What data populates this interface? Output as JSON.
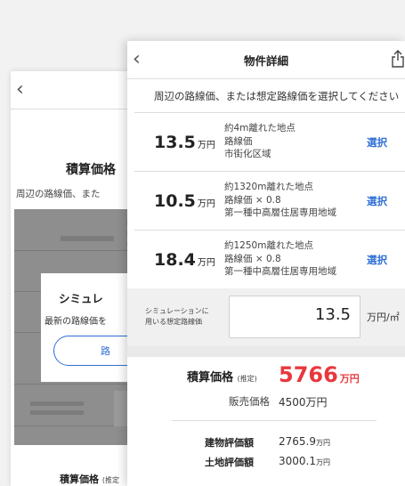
{
  "back": {
    "title": "積算価格",
    "subtitle": "周辺の路線価、また",
    "modal": {
      "title": "シミュレ",
      "description": "最新の路線価を",
      "button_label": "路"
    },
    "bottom_label": "積算価格",
    "bottom_label_note": "(推定"
  },
  "detail": {
    "title": "物件詳細",
    "instruction": "周辺の路線価、または想定路線価を選択してください",
    "options": [
      {
        "price": "13.5",
        "unit": "万円",
        "lines": [
          "約4m離れた地点",
          "路線価",
          "市街化区域"
        ],
        "select": "選択"
      },
      {
        "price": "10.5",
        "unit": "万円",
        "lines": [
          "約1320m離れた地点",
          "路線価 × 0.8",
          "第一種中高層住居専用地域"
        ],
        "select": "選択"
      },
      {
        "price": "18.4",
        "unit": "万円",
        "lines": [
          "約1250m離れた地点",
          "路線価 × 0.8",
          "第一種中高層住居専用地域"
        ],
        "select": "選択"
      }
    ],
    "simulation": {
      "label_line1": "シミュレーションに",
      "label_line2": "用いる想定路線価",
      "value": "13.5",
      "unit": "万円/㎡"
    },
    "result": {
      "estimated_label": "積算価格",
      "estimated_note": "(推定)",
      "estimated_value": "5766",
      "estimated_unit": "万円",
      "sale_label": "販売価格",
      "sale_value": "4500万円",
      "building_label": "建物評価額",
      "building_value": "2765.9",
      "building_unit": "万円",
      "land_label": "土地評価額",
      "land_value": "3000.1",
      "land_unit": "万円"
    }
  },
  "colors": {
    "accent": "#2f6fd6",
    "highlight": "#e8383d"
  }
}
